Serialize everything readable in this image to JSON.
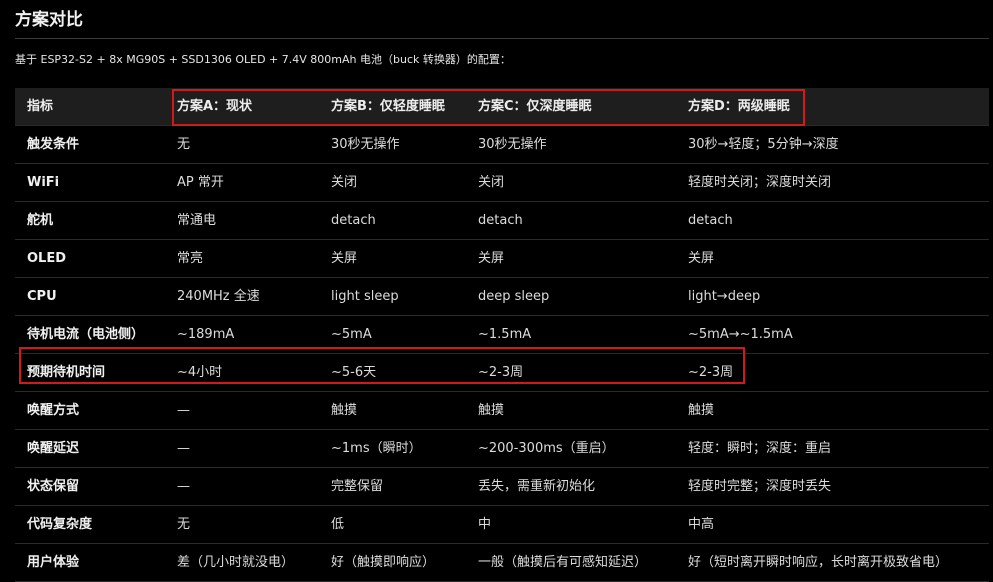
{
  "title": "方案对比",
  "intro": "基于 ESP32-S2 + 8x MG90S + SSD1306 OLED + 7.4V 800mAh 电池（buck 转换器）的配置：",
  "colors": {
    "background": "#000000",
    "header_bg": "#1e1e1e",
    "highlight": "#d11a1a"
  },
  "table": {
    "headers": [
      "指标",
      "方案A：现状",
      "方案B：仅轻度睡眠",
      "方案C：仅深度睡眠",
      "方案D：两级睡眠"
    ],
    "rows": [
      [
        "触发条件",
        "无",
        "30秒无操作",
        "30秒无操作",
        "30秒→轻度；5分钟→深度"
      ],
      [
        "WiFi",
        "AP 常开",
        "关闭",
        "关闭",
        "轻度时关闭；深度时关闭"
      ],
      [
        "舵机",
        "常通电",
        "detach",
        "detach",
        "detach"
      ],
      [
        "OLED",
        "常亮",
        "关屏",
        "关屏",
        "关屏"
      ],
      [
        "CPU",
        "240MHz 全速",
        "light sleep",
        "deep sleep",
        "light→deep"
      ],
      [
        "待机电流（电池侧）",
        "~189mA",
        "~5mA",
        "~1.5mA",
        "~5mA→~1.5mA"
      ],
      [
        "预期待机时间",
        "~4小时",
        "~5-6天",
        "~2-3周",
        "~2-3周"
      ],
      [
        "唤醒方式",
        "—",
        "触摸",
        "触摸",
        "触摸"
      ],
      [
        "唤醒延迟",
        "—",
        "~1ms（瞬时）",
        "~200-300ms（重启）",
        "轻度：瞬时；深度：重启"
      ],
      [
        "状态保留",
        "—",
        "完整保留",
        "丢失，需重新初始化",
        "轻度时完整；深度时丢失"
      ],
      [
        "代码复杂度",
        "无",
        "低",
        "中",
        "中高"
      ],
      [
        "用户体验",
        "差（几小时就没电）",
        "好（触摸即响应）",
        "一般（触摸后有可感知延迟）",
        "好（短时离开瞬时响应，长时离开极致省电）"
      ]
    ]
  }
}
